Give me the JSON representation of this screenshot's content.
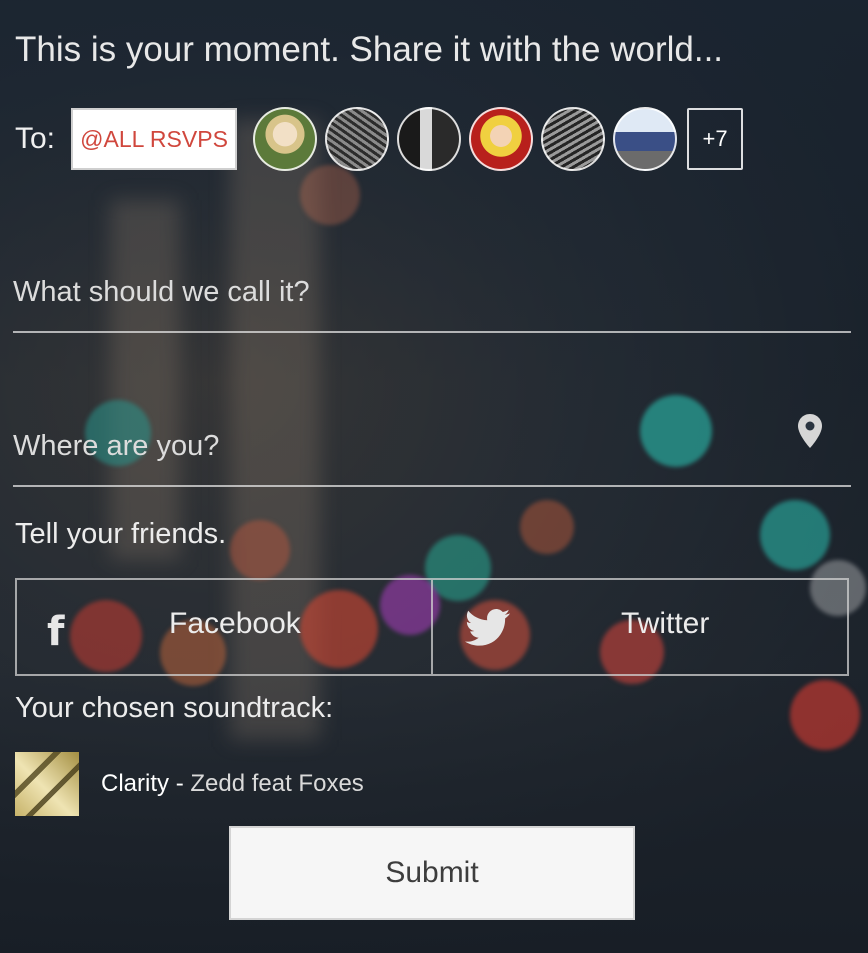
{
  "headline": "This is your moment. Share it with the world...",
  "recipients": {
    "to_label": "To:",
    "chip_label": "@ALL RSVPS",
    "more_label": "+7"
  },
  "fields": {
    "name_placeholder": "What should we call it?",
    "location_placeholder": "Where are you?"
  },
  "share": {
    "heading": "Tell your friends.",
    "facebook_label": "Facebook",
    "twitter_label": "Twitter"
  },
  "soundtrack": {
    "heading": "Your chosen soundtrack:",
    "title": "Clarity",
    "separator": "-",
    "artist": "Zedd feat Foxes"
  },
  "submit_label": "Submit",
  "icons": {
    "location": "map-pin-icon",
    "facebook": "facebook-icon",
    "twitter": "twitter-bird-icon"
  },
  "colors": {
    "chip_text": "#d0473d",
    "submit_bg": "#f6f6f6"
  }
}
